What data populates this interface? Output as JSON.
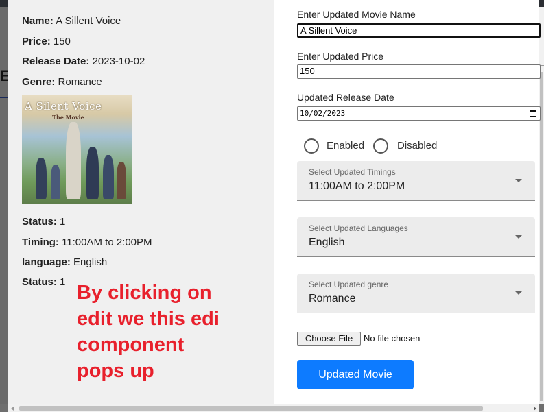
{
  "backdrop": {
    "fragment_text": "Ec"
  },
  "details": {
    "name_label": "Name:",
    "name_value": "A Sillent Voice",
    "price_label": "Price:",
    "price_value": "150",
    "release_label": "Release Date:",
    "release_value": "2023-10-02",
    "genre_label": "Genre:",
    "genre_value": "Romance",
    "status_label": "Status:",
    "status_value": "1",
    "timing_label": "Timing:",
    "timing_value": "11:00AM to 2:00PM",
    "language_label": "language:",
    "language_value": "English",
    "status2_label": "Status:",
    "status2_value": "1"
  },
  "poster": {
    "title": "A Silent Voice",
    "subtitle": "The Movie"
  },
  "callout": {
    "lines": [
      "By clicking on",
      "edit we this edi",
      "component",
      "pops up"
    ],
    "color": "#e8202c"
  },
  "form": {
    "name_label": "Enter Updated Movie Name",
    "name_value": "A Sillent Voice",
    "price_label": "Enter Updated Price",
    "price_value": "150",
    "date_label": "Updated Release Date",
    "date_value": "10/02/2023",
    "radio_enabled": "Enabled",
    "radio_disabled": "Disabled",
    "timings_label": "Select Updated Timings",
    "timings_value": "11:00AM to 2:00PM",
    "languages_label": "Select Updated Languages",
    "languages_value": "English",
    "genre_label": "Select Updated genre",
    "genre_value": "Romance",
    "file_button": "Choose File",
    "file_status": "No file chosen",
    "submit_label": "Updated Movie",
    "accent": "#0d7bff"
  }
}
